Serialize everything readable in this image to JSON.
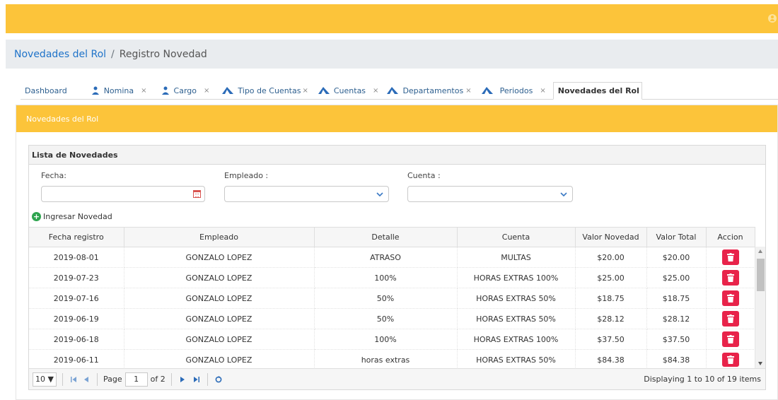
{
  "breadcrumb": {
    "parent": "Novedades del Rol",
    "separator": "/",
    "current": "Registro Novedad"
  },
  "tabs": [
    {
      "label": "Dashboard",
      "icon": "",
      "closable": false
    },
    {
      "label": "Nomina",
      "icon": "users-icon",
      "closable": true
    },
    {
      "label": "Cargo",
      "icon": "users-icon",
      "closable": true
    },
    {
      "label": "Tipo de Cuentas",
      "icon": "mountain-icon",
      "closable": true
    },
    {
      "label": "Cuentas",
      "icon": "mountain-icon",
      "closable": true
    },
    {
      "label": "Departamentos",
      "icon": "mountain-icon",
      "closable": true
    },
    {
      "label": "Periodos",
      "icon": "mountain-icon",
      "closable": true
    },
    {
      "label": "Novedades del Rol",
      "icon": "money-icon",
      "closable": false,
      "active": true
    }
  ],
  "tab_close_symbol": "×",
  "panel": {
    "title": "Novedades del Rol"
  },
  "lista": {
    "title": "Lista de Novedades"
  },
  "filters": {
    "fecha_label": "Fecha:",
    "empleado_label": "Empleado :",
    "cuenta_label": "Cuenta :",
    "fecha_value": "",
    "empleado_value": "",
    "cuenta_value": ""
  },
  "add_button": "Ingresar Novedad",
  "table": {
    "headers": [
      "Fecha registro",
      "Empleado",
      "Detalle",
      "Cuenta",
      "Valor Novedad",
      "Valor Total",
      "Accion"
    ],
    "rows": [
      [
        "2019-08-01",
        "GONZALO LOPEZ",
        "ATRASO",
        "MULTAS",
        "$20.00",
        "$20.00"
      ],
      [
        "2019-07-23",
        "GONZALO LOPEZ",
        "100%",
        "HORAS EXTRAS 100%",
        "$25.00",
        "$25.00"
      ],
      [
        "2019-07-16",
        "GONZALO LOPEZ",
        "50%",
        "HORAS EXTRAS 50%",
        "$18.75",
        "$18.75"
      ],
      [
        "2019-06-19",
        "GONZALO LOPEZ",
        "50%",
        "HORAS EXTRAS 50%",
        "$28.12",
        "$28.12"
      ],
      [
        "2019-06-18",
        "GONZALO LOPEZ",
        "100%",
        "HORAS EXTRAS 100%",
        "$37.50",
        "$37.50"
      ],
      [
        "2019-06-11",
        "GONZALO LOPEZ",
        "horas extras",
        "HORAS EXTRAS 50%",
        "$84.38",
        "$84.38"
      ]
    ]
  },
  "pager": {
    "page_size": "10 ▼",
    "page_label": "Page",
    "page_value": "1",
    "of_label": "of 2",
    "display": "Displaying 1 to 10 of 19 items"
  },
  "colors": {
    "accent": "#fcc43a",
    "link": "#1f73c9",
    "delete": "#e8234a",
    "add": "#2ea44f"
  }
}
